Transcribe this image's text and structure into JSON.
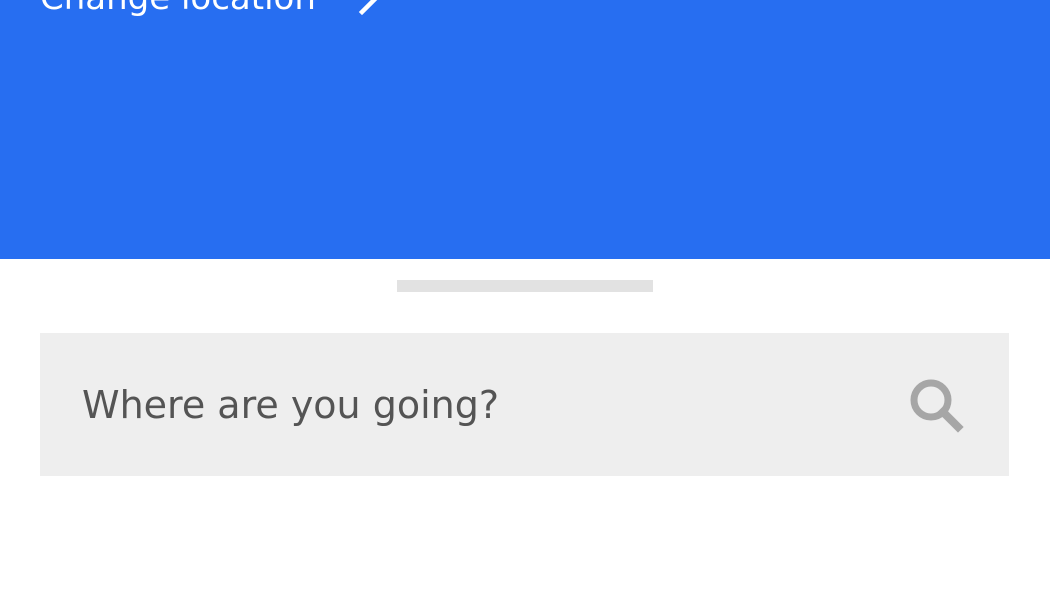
{
  "header": {
    "change_location_label": "Change location",
    "chevron_icon": "chevron-right-icon",
    "background_color": "#276ef1"
  },
  "sheet": {
    "handle_icon": "drag-handle"
  },
  "search": {
    "placeholder": "Where are you going?",
    "icon": "search-icon"
  },
  "colors": {
    "accent": "#276ef1",
    "search_bg": "#eeeeee",
    "placeholder_text": "#545454",
    "icon_gray": "#a6a6a6"
  }
}
